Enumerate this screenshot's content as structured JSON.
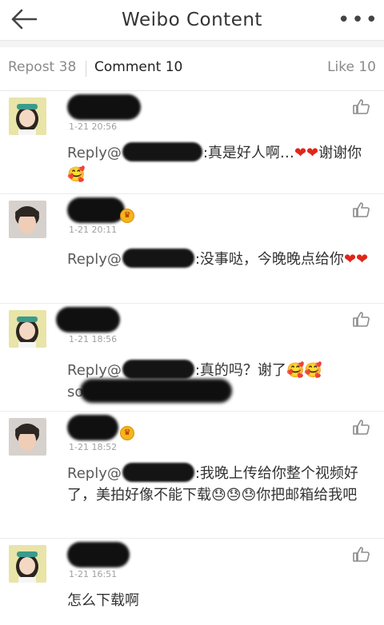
{
  "header": {
    "title": "Weibo Content",
    "back_icon": "arrow-left-icon",
    "more_label": "•••"
  },
  "tabs": {
    "repost": "Repost 38",
    "comment": "Comment 10",
    "like": "Like 10"
  },
  "comments": [
    {
      "time": "1-21 20:56",
      "reply_prefix": "Reply@",
      "text_before": ":真是好人啊…",
      "text_after": "谢谢你",
      "emojis_mid": [
        "❤",
        "❤"
      ],
      "emojis_end": [
        "🥰"
      ]
    },
    {
      "time": "1-21 20:11",
      "reply_prefix": "Reply@",
      "text_before": ":没事哒，今晚晚点给你",
      "emojis_end": [
        "❤",
        "❤"
      ]
    },
    {
      "time": "1-21 18:56",
      "reply_prefix": "Reply@",
      "text_before": ":真的吗？谢了",
      "emojis_end": [
        "🥰",
        "🥰"
      ],
      "tail": "so"
    },
    {
      "time": "1-21 18:52",
      "reply_prefix": "Reply@",
      "text_before": ":我晚上传给你整个视频好了，美拍好像不能下载",
      "emojis_mid": [
        "😓",
        "😓",
        "😓"
      ],
      "text_after": "你把邮箱给我吧"
    },
    {
      "time": "1-21 16:51",
      "text": "怎么下载啊"
    }
  ],
  "colors": {
    "heart": "#e0261b",
    "vip": "#f3b61b",
    "timestamp": "#a0a0a0"
  }
}
